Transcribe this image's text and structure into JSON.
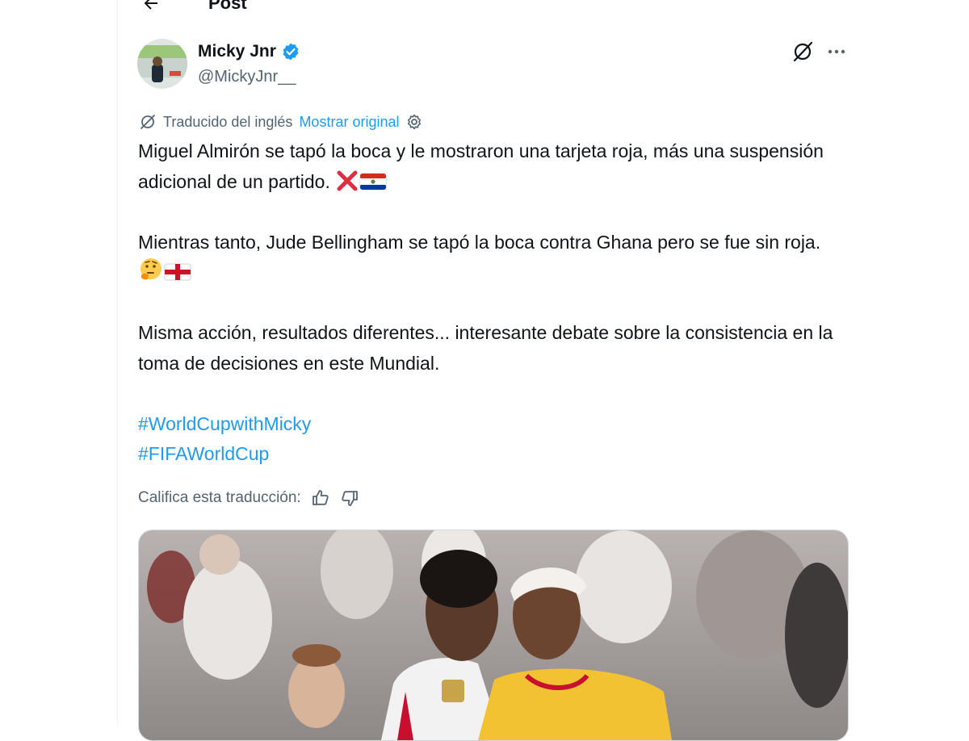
{
  "header": {
    "title": "Post",
    "back_icon": "arrow-left-icon"
  },
  "author": {
    "name": "Micky Jnr",
    "handle": "@MickyJnr__",
    "verified_color": "#1d9bf0",
    "icons": [
      "verified-badge-icon",
      "grok-icon",
      "more-icon"
    ]
  },
  "translation": {
    "label": "Traducido del inglés",
    "show_original": "Mostrar original",
    "icons": [
      "translate-icon",
      "gear-icon"
    ]
  },
  "tweet": {
    "paragraph_1": "Miguel Almirón se tapó la boca y le mostraron una tarjeta roja, más una suspensión adicional de un partido.",
    "paragraph_2": "Mientras tanto, Jude Bellingham se tapó la boca contra Ghana pero se fue sin roja.",
    "paragraph_3": "Misma acción, resultados diferentes... interesante debate sobre la consistencia en la toma de decisiones en este Mundial.",
    "hashtag_1": "#WorldCupwithMicky",
    "hashtag_2": "#FIFAWorldCup",
    "emojis": [
      "cross-mark",
      "flag-paraguay",
      "thinking-face",
      "flag-england"
    ]
  },
  "rating": {
    "label": "Califica esta traducción:",
    "icons": [
      "thumbs-up-icon",
      "thumbs-down-icon"
    ]
  },
  "colors": {
    "link": "#1d9bf0",
    "secondary_text": "#536471",
    "text": "#0f1419"
  }
}
